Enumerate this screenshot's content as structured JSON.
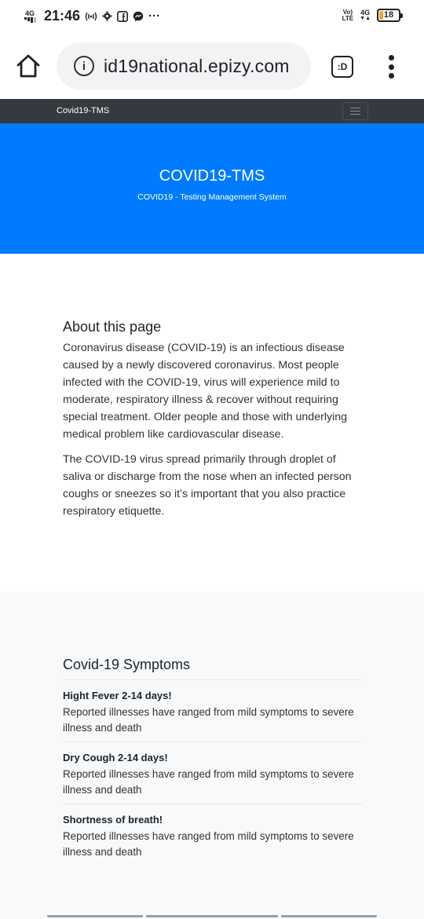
{
  "status_bar": {
    "network_left": "4G",
    "time": "21:46",
    "icons": [
      "hotspot-icon",
      "gear-icon",
      "facebook-icon",
      "messenger-icon",
      "more-dots-icon"
    ],
    "more": "···",
    "volte_top": "Vo)",
    "volte_bottom": "LTE",
    "network_right": "4G",
    "battery": "18",
    "battery_level_percent": 18,
    "battery_color": "#f5a623"
  },
  "browser": {
    "url": "id19national.epizy.com",
    "tab_label": ":D"
  },
  "navbar": {
    "brand": "Covid19-TMS"
  },
  "hero": {
    "title": "COVID19-TMS",
    "subtitle": "COVID19 - Testing Management System",
    "bg_color": "#007bff"
  },
  "about": {
    "heading": "About this page",
    "paragraph1": "Coronavirus disease (COVID-19) is an infectious disease caused by a newly discovered coronavirus. Most people infected with the COVID-19, virus will experience mild to moderate, respiratory illness & recover without requiring special treatment. Older people and those with underlying medical problem like cardiovascular disease.",
    "paragraph2": "The COVID-19 virus spread primarily through droplet of saliva or discharge from the nose when an infected person coughs or sneezes so it’s important that you also practice respiratory etiquette."
  },
  "symptoms": {
    "heading": "Covid-19 Symptoms",
    "items": [
      {
        "title": "Hight Fever 2-14 days!",
        "desc": "Reported illnesses have ranged from mild symptoms to severe illness and death"
      },
      {
        "title": "Dry Cough 2-14 days!",
        "desc": "Reported illnesses have ranged from mild symptoms to severe illness and death"
      },
      {
        "title": "Shortness of breath!",
        "desc": "Reported illnesses have ranged from mild symptoms to severe illness and death"
      }
    ]
  }
}
